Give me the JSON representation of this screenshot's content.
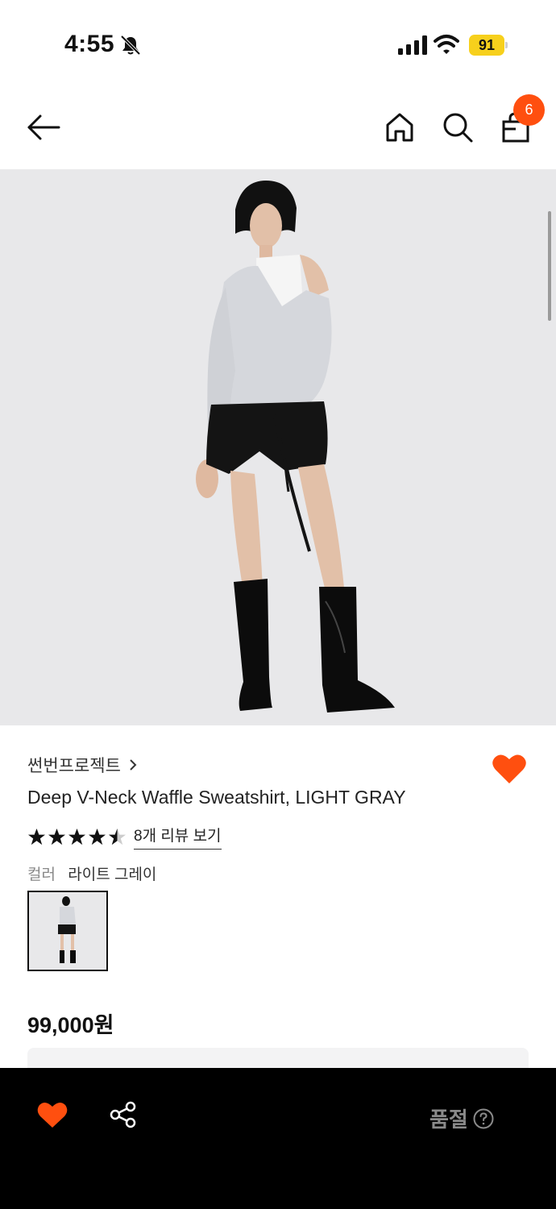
{
  "status_bar": {
    "time": "4:55",
    "battery": "91"
  },
  "header": {
    "cart_count": "6"
  },
  "product": {
    "brand": "썬번프로젝트",
    "name": "Deep V-Neck Waffle Sweatshirt, LIGHT GRAY",
    "rating": 4.5,
    "reviews_link": "8개 리뷰 보기",
    "color_label": "컬러",
    "color_value": "라이트 그레이",
    "price": "99,000원"
  },
  "bottom_bar": {
    "status": "품절"
  },
  "colors": {
    "accent": "#ff4f0f",
    "battery": "#f7d01c",
    "hero_bg": "#e8e8ea"
  },
  "icons": [
    "bell-slash-icon",
    "signal-icon",
    "wifi-icon",
    "back-arrow-icon",
    "home-icon",
    "search-icon",
    "shopping-bag-icon",
    "chevron-right-icon",
    "heart-icon",
    "star-icon",
    "share-icon",
    "help-icon"
  ]
}
